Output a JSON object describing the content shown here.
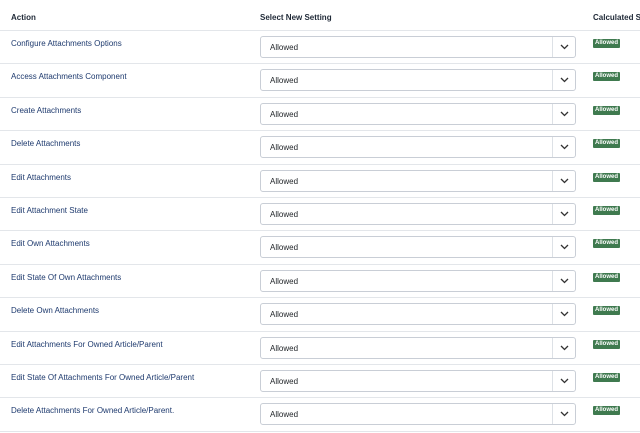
{
  "header": {
    "action": "Action",
    "select_new_setting": "Select New Setting",
    "calculated_setting": "Calculated Se"
  },
  "icons": {
    "dropdown": "chevron-down-icon"
  },
  "colors": {
    "badge_allowed": "#3f7a4f",
    "action_text": "#1e3a6e"
  },
  "rows": [
    {
      "action": "Configure Attachments Options",
      "setting": "Allowed",
      "calculated": "Allowed"
    },
    {
      "action": "Access Attachments Component",
      "setting": "Allowed",
      "calculated": "Allowed"
    },
    {
      "action": "Create Attachments",
      "setting": "Allowed",
      "calculated": "Allowed"
    },
    {
      "action": "Delete Attachments",
      "setting": "Allowed",
      "calculated": "Allowed"
    },
    {
      "action": "Edit Attachments",
      "setting": "Allowed",
      "calculated": "Allowed"
    },
    {
      "action": "Edit Attachment State",
      "setting": "Allowed",
      "calculated": "Allowed"
    },
    {
      "action": "Edit Own Attachments",
      "setting": "Allowed",
      "calculated": "Allowed"
    },
    {
      "action": "Edit State Of Own Attachments",
      "setting": "Allowed",
      "calculated": "Allowed"
    },
    {
      "action": "Delete Own Attachments",
      "setting": "Allowed",
      "calculated": "Allowed"
    },
    {
      "action": "Edit Attachments For Owned Article/Parent",
      "setting": "Allowed",
      "calculated": "Allowed"
    },
    {
      "action": "Edit State Of Attachments For Owned Article/Parent",
      "setting": "Allowed",
      "calculated": "Allowed"
    },
    {
      "action": "Delete Attachments For Owned Article/Parent.",
      "setting": "Allowed",
      "calculated": "Allowed"
    }
  ]
}
